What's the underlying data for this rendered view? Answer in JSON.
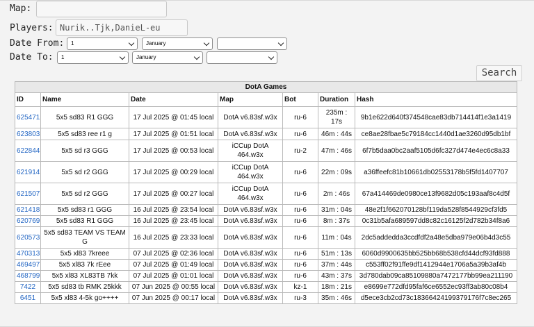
{
  "form": {
    "map_label": "Map:",
    "map_value": "",
    "players_label": "Players:",
    "players_value": "Nurik..Tjk,DanieL-eu",
    "date_from_label": "Date From:",
    "date_from": {
      "day": "1",
      "month": "January",
      "year": ""
    },
    "date_to_label": "Date To:",
    "date_to": {
      "day": "1",
      "month": "January",
      "year": ""
    },
    "search_label": "Search"
  },
  "table": {
    "caption": "DotA Games",
    "columns": [
      "ID",
      "Name",
      "Date",
      "Map",
      "Bot",
      "Duration",
      "Hash"
    ],
    "rows": [
      {
        "id": "625471",
        "name": "5x5 sd83 R1 GGG",
        "date": "17 Jul 2025 @ 01:45 local",
        "map": "DotA v6.83sf.w3x",
        "bot": "ru-6",
        "duration": "235m : 17s",
        "hash": "9b1e622d640f374548cae83db714414f1e3a1419"
      },
      {
        "id": "623803",
        "name": "5x5 sd83 ree r1 g",
        "date": "17 Jul 2025 @ 01:51 local",
        "map": "DotA v6.83sf.w3x",
        "bot": "ru-6",
        "duration": "46m : 44s",
        "hash": "ce8ae28fbae5c79184cc1440d1ae3260d95db1bf"
      },
      {
        "id": "622844",
        "name": "5x5 sd r3 GGG",
        "date": "17 Jul 2025 @ 00:53 local",
        "map": "iCCup DotA 464.w3x",
        "bot": "ru-2",
        "duration": "47m : 46s",
        "hash": "6f7b5daa0bc2aaf5105d6fc327d474e4ec6c8a33"
      },
      {
        "id": "621914",
        "name": "5x5 sd r2 GGG",
        "date": "17 Jul 2025 @ 00:29 local",
        "map": "iCCup DotA 464.w3x",
        "bot": "ru-6",
        "duration": "22m : 09s",
        "hash": "a36ffeefc81b10661db02553178b5f5fd1407707"
      },
      {
        "id": "621507",
        "name": "5x5 sd r2 GGG",
        "date": "17 Jul 2025 @ 00:27 local",
        "map": "iCCup DotA 464.w3x",
        "bot": "ru-6",
        "duration": "2m : 46s",
        "hash": "67a414469de0980ce13f9682d05c193aaf8c4d5f"
      },
      {
        "id": "621418",
        "name": "5x5 sd83 r1 GGG",
        "date": "16 Jul 2025 @ 23:54 local",
        "map": "DotA v6.83sf.w3x",
        "bot": "ru-6",
        "duration": "31m : 04s",
        "hash": "48e2f1f662070128bf119da528f8544929cf3fd5"
      },
      {
        "id": "620769",
        "name": "5x5 sd83 R1 GGG",
        "date": "16 Jul 2025 @ 23:45 local",
        "map": "DotA v6.83sf.w3x",
        "bot": "ru-6",
        "duration": "8m : 37s",
        "hash": "0c31b5afa689597dd8c82c16125f2d782b34f8a6"
      },
      {
        "id": "620573",
        "name": "5x5 sd83 TEAM VS TEAM G",
        "date": "16 Jul 2025 @ 23:33 local",
        "map": "DotA v6.83sf.w3x",
        "bot": "ru-6",
        "duration": "11m : 04s",
        "hash": "2dc5addedda3ccdfdf2a48e5dba979e06b4d3c55"
      },
      {
        "id": "470313",
        "name": "5x5 xl83 7kreee",
        "date": "07 Jul 2025 @ 02:36 local",
        "map": "DotA v6.83sf.w3x",
        "bot": "ru-6",
        "duration": "51m : 13s",
        "hash": "6060d9900635bb525bb68b538cfd44dcf93fd888"
      },
      {
        "id": "469497",
        "name": "5x5 xl83 7k rEee",
        "date": "07 Jul 2025 @ 01:49 local",
        "map": "DotA v6.83sf.w3x",
        "bot": "ru-6",
        "duration": "37m : 44s",
        "hash": "c553ff02f91ffe9df1412944e1706a5a39b3af4b"
      },
      {
        "id": "468799",
        "name": "5x5 xl83 XL83TB 7kk",
        "date": "07 Jul 2025 @ 01:01 local",
        "map": "DotA v6.83sf.w3x",
        "bot": "ru-6",
        "duration": "43m : 37s",
        "hash": "3d780dab09ca85109880a7472177bb99ea211190"
      },
      {
        "id": "7422",
        "name": "5x5 sd83 tb RMK 25kkk",
        "date": "07 Jun 2025 @ 00:55 local",
        "map": "DotA v6.83sf.w3x",
        "bot": "kz-1",
        "duration": "18m : 21s",
        "hash": "e8699e772dfd95faf6ce6552ec93ff3ab80c08b4"
      },
      {
        "id": "6451",
        "name": "5x5 xl83 4-5k go++++",
        "date": "07 Jun 2025 @ 00:17 local",
        "map": "DotA v6.83sf.w3x",
        "bot": "ru-3",
        "duration": "35m : 46s",
        "hash": "d5ece3cb2cd73c18366424199379176f7c8ec265"
      }
    ]
  }
}
